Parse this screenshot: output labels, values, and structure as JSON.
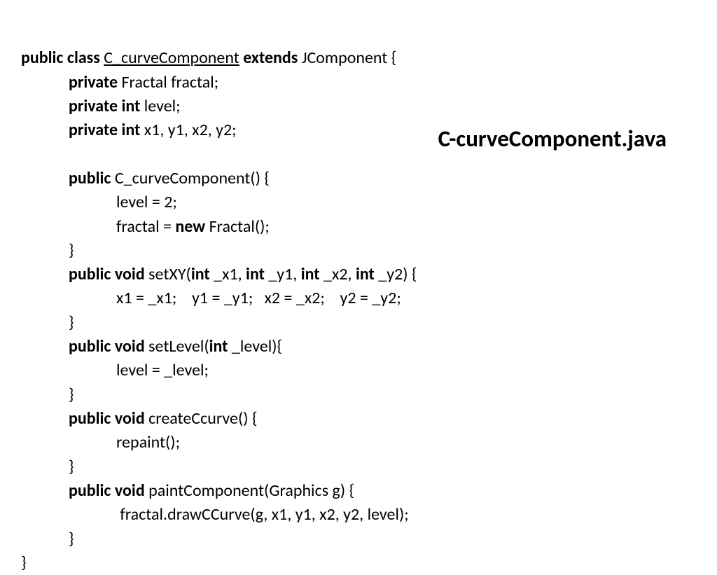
{
  "title": "C-curveComponent.java",
  "code": {
    "l1_a": "public class ",
    "l1_b": "C_curveComponent",
    "l1_c": " extends ",
    "l1_d": "JComponent {",
    "l2_a": "private ",
    "l2_b": "Fractal fractal;",
    "l3_a": "private int ",
    "l3_b": "level;",
    "l4_a": "private int ",
    "l4_b": "x1, y1, x2, y2;",
    "l5": " ",
    "l6_a": "public ",
    "l6_b": "C_curveComponent() {",
    "l7": "level = 2;",
    "l8_a": "fractal = ",
    "l8_b": "new ",
    "l8_c": "Fractal();",
    "l9": "}",
    "l10_a": "public void ",
    "l10_b": "setXY(",
    "l10_c": "int ",
    "l10_d": "_x1, ",
    "l10_e": "int ",
    "l10_f": "_y1, ",
    "l10_g": "int ",
    "l10_h": "_x2, ",
    "l10_i": "int ",
    "l10_j": "_y2) {",
    "l11": "x1 = _x1;    y1 = _y1;   x2 = _x2;    y2 = _y2;",
    "l12": "}",
    "l13_a": "public void ",
    "l13_b": "setLevel(",
    "l13_c": "int ",
    "l13_d": "_level){",
    "l14": "level = _level;",
    "l15": "}",
    "l16_a": "public void ",
    "l16_b": "createCcurve() {",
    "l17": "repaint();",
    "l18": "}",
    "l19_a": "public void ",
    "l19_b": "paintComponent(Graphics g) {",
    "l20": " fractal.drawCCurve(g, x1, y1, x2, y2, level);",
    "l21": "}",
    "l22": "}"
  }
}
